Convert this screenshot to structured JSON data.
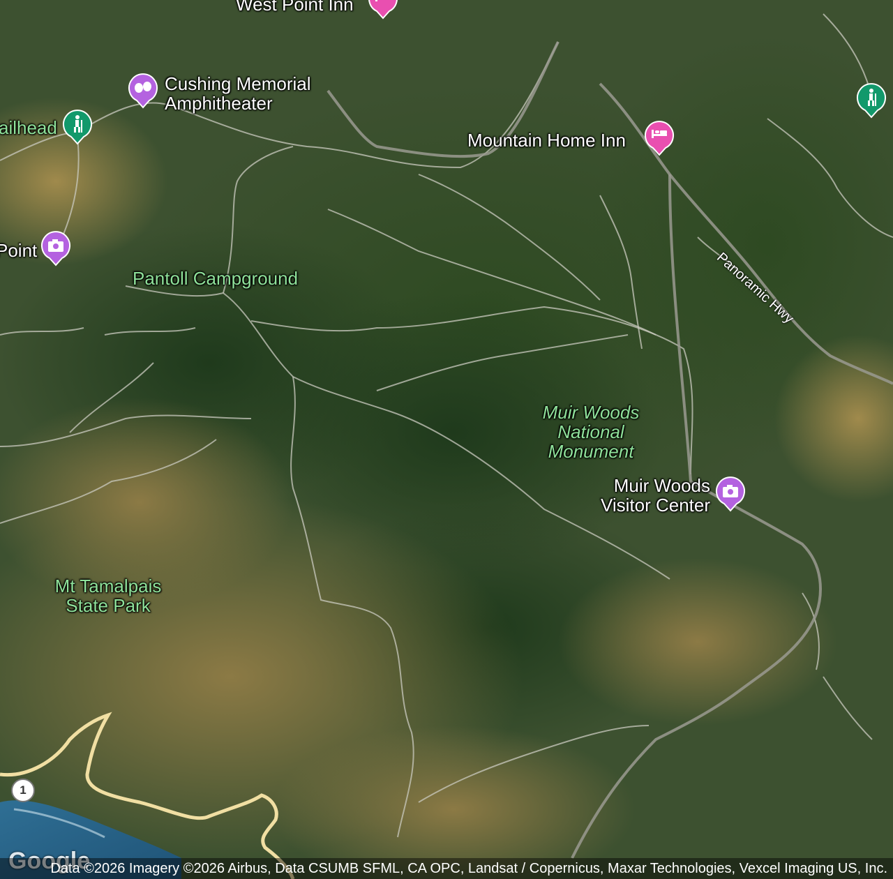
{
  "places": {
    "west_point_inn": "West Point Inn",
    "cushing_memorial": [
      "Cushing Memorial",
      "Amphitheater"
    ],
    "trailhead": "ailhead",
    "mountain_home_inn": "Mountain Home Inn",
    "point": "Point",
    "pantoll": "Pantoll Campground",
    "muir_woods": [
      "Muir Woods",
      "National",
      "Monument"
    ],
    "visitor_center": [
      "Muir Woods",
      "Visitor Center"
    ],
    "mt_tam": [
      "Mt Tamalpais",
      "State Park"
    ]
  },
  "roads": {
    "panoramic": "Panoramic Hwy",
    "route_shield": "1"
  },
  "icons": {
    "lodging": "bed-icon",
    "theater": "theater-masks-icon",
    "hiking": "hiker-icon",
    "camera": "camera-icon"
  },
  "colors": {
    "lodging_pin": "#e94fb0",
    "attraction_pin": "#b462e0",
    "hiking_pin": "#12996b",
    "park_label": "#8fe29a",
    "highway": "#f1dfa3"
  },
  "attribution": "Data ©2026 Imagery ©2026 Airbus, Data CSUMB SFML, CA OPC, Landsat / Copernicus, Maxar Technologies, Vexcel Imaging US, Inc.",
  "logo": "Google"
}
